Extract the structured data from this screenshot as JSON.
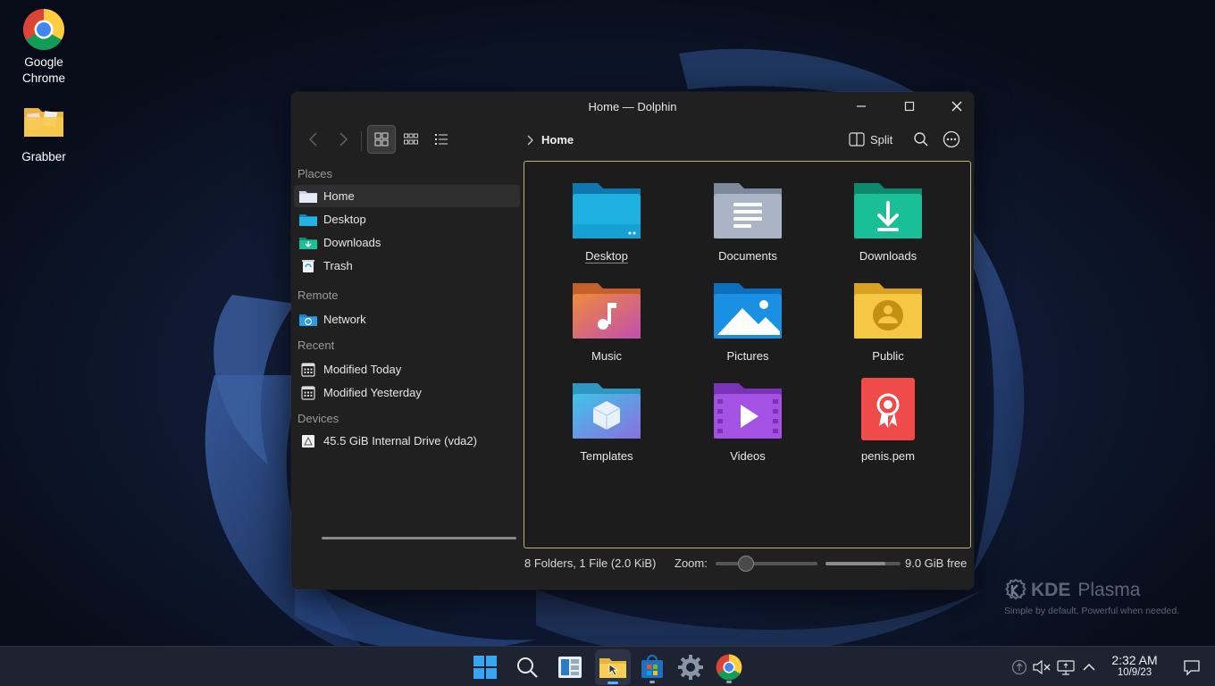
{
  "desktop": {
    "icons": [
      {
        "label": "Google Chrome",
        "icon": "chrome-icon"
      },
      {
        "label": "Grabber",
        "icon": "folder-icon"
      }
    ]
  },
  "window": {
    "title": "Home — Dolphin",
    "controls": {
      "minimize": "minimize-icon",
      "maximize": "maximize-icon",
      "close": "close-icon"
    }
  },
  "toolbar": {
    "breadcrumb": "Home",
    "split_label": "Split"
  },
  "sidebar": {
    "sections": {
      "places": "Places",
      "remote": "Remote",
      "recent": "Recent",
      "devices": "Devices"
    },
    "places": [
      {
        "label": "Home",
        "icon": "home-folder-icon",
        "selected": true
      },
      {
        "label": "Desktop",
        "icon": "desktop-folder-icon"
      },
      {
        "label": "Downloads",
        "icon": "downloads-folder-icon"
      },
      {
        "label": "Trash",
        "icon": "trash-icon"
      }
    ],
    "remote": [
      {
        "label": "Network",
        "icon": "network-icon"
      }
    ],
    "recent": [
      {
        "label": "Modified Today",
        "icon": "calendar-icon"
      },
      {
        "label": "Modified Yesterday",
        "icon": "calendar-icon"
      }
    ],
    "devices": [
      {
        "label": "45.5 GiB Internal Drive (vda2)",
        "icon": "drive-icon",
        "usage_fraction": 1.0
      }
    ]
  },
  "content": {
    "items": [
      {
        "label": "Desktop",
        "icon": "desktop-folder-icon",
        "color": "#1aa7d8"
      },
      {
        "label": "Documents",
        "icon": "documents-folder-icon",
        "color": "#9aa6b8"
      },
      {
        "label": "Downloads",
        "icon": "downloads-folder-icon",
        "color": "#1bb394"
      },
      {
        "label": "Music",
        "icon": "music-folder-icon",
        "color": "#e0637a"
      },
      {
        "label": "Pictures",
        "icon": "pictures-folder-icon",
        "color": "#1a8ee0"
      },
      {
        "label": "Public",
        "icon": "public-folder-icon",
        "color": "#f2c23c"
      },
      {
        "label": "Templates",
        "icon": "templates-folder-icon",
        "color": "#4fb3e0"
      },
      {
        "label": "Videos",
        "icon": "videos-folder-icon",
        "color": "#a04ee0"
      },
      {
        "label": "penis.pem",
        "icon": "certificate-file-icon",
        "color": "#ef4b4b"
      }
    ]
  },
  "status": {
    "summary": "8 Folders, 1 File (2.0 KiB)",
    "zoom_label": "Zoom:",
    "zoom_level": 0.3,
    "free_label": "9.0 GiB free",
    "used_fraction": 0.8
  },
  "watermark": {
    "brand_kde": "KDE",
    "brand_plasma": "Plasma",
    "tagline": "Simple by default, Powerful when  needed."
  },
  "taskbar": {
    "apps": [
      "start-icon",
      "search-icon",
      "widgets-icon",
      "file-manager-icon",
      "store-icon",
      "settings-icon",
      "chrome-icon"
    ],
    "clock_time": "2:32 AM",
    "clock_date": "10/9/23"
  }
}
